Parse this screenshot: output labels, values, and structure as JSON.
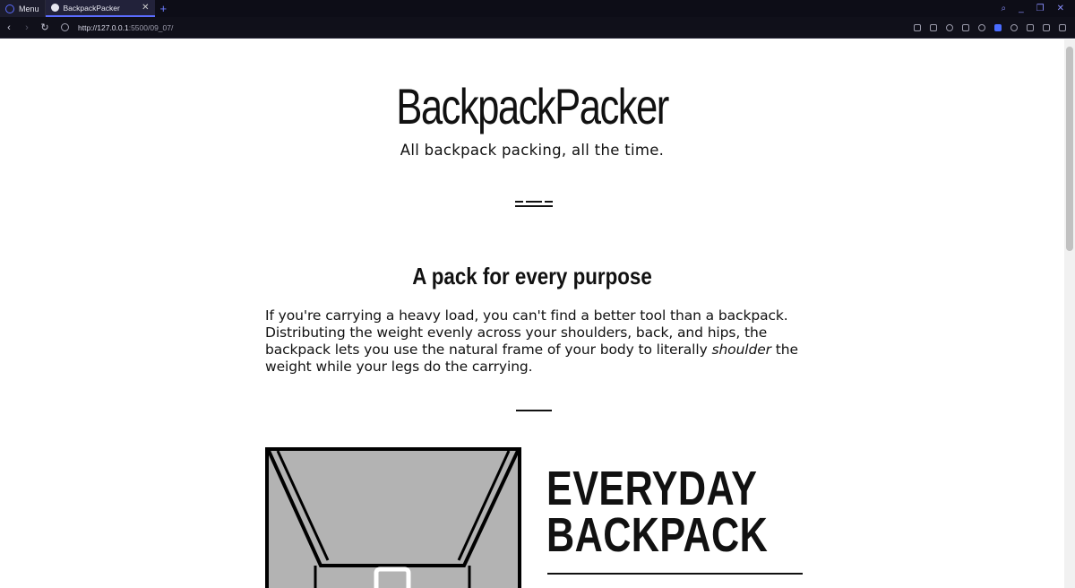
{
  "browser": {
    "menu_label": "Menu",
    "tab_title": "BackpackPacker",
    "new_tab": "+",
    "url_host": "http://127.0.0.1",
    "url_path": ":5500/09_07/",
    "accent": "#5b6cff"
  },
  "page": {
    "site_title": "BackpackPacker",
    "tagline": "All backpack packing, all the time.",
    "section_title": "A pack for every purpose",
    "intro_before": "If you're carrying a heavy load, you can't find a better tool than a backpack. Distributing the weight evenly across your shoulders, back, and hips, the backpack lets you use the natural frame of your body to literally ",
    "intro_emph": "shoulder",
    "intro_after": " the weight while your legs do the carrying.",
    "product_title_line1": "EVERYDAY",
    "product_title_line2": "BACKPACK"
  },
  "icons": {
    "back": "back-arrow-icon",
    "forward": "forward-arrow-icon",
    "reload": "reload-icon",
    "site_info": "globe-icon",
    "search": "search-icon",
    "backpack_illustration": "backpack-illustration"
  }
}
